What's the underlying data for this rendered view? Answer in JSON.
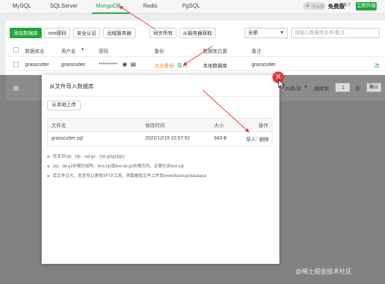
{
  "tabs": [
    {
      "label": "MySQL",
      "active": false
    },
    {
      "label": "SQLServer",
      "active": false
    },
    {
      "label": "MongoDB",
      "active": true
    },
    {
      "label": "Redis",
      "active": false
    },
    {
      "label": "PgSQL",
      "active": false
    }
  ],
  "header": {
    "vip_text": "专业版",
    "free_label": "免费版",
    "version": "7.9.7",
    "upgrade_label": "立即升级"
  },
  "toolbar": {
    "add_db": "添加数据库",
    "root_pwd": "root密码",
    "security": "安全认证",
    "remote_server": "远程服务器",
    "sync_all": "同步所有",
    "fetch_server": "从服务器获取",
    "filter_value": "全部",
    "search_placeholder": "请输入数据库名称/备注"
  },
  "table": {
    "headers": {
      "name": "数据库名",
      "user": "用户名",
      "password": "密码",
      "backup": "备份",
      "location": "数据库位置",
      "remark": "备注"
    },
    "row": {
      "name": "grasscutter",
      "user": "grasscutter",
      "password": "**********",
      "backup_status": "点击备份",
      "backup_sep": "|",
      "import": "导入",
      "location": "本地数据库",
      "remark": "grasscutter",
      "action_edge": "改"
    }
  },
  "pager": {
    "size": "20条/页",
    "goto": "跳转到",
    "page": "1",
    "unit": "页",
    "confirm": "确认"
  },
  "modal": {
    "title": "从文件导入数据库",
    "upload_button": "从本地上传",
    "file_table": {
      "headers": [
        "文件名",
        "修改时间",
        "大小",
        "操作"
      ],
      "rows": [
        {
          "name": "grasscutter.sql",
          "mtime": "2022/12/19 22:57:52",
          "size": "843 B",
          "import": "导入",
          "sep": "|",
          "delete": "删除"
        }
      ]
    },
    "notes": [
      "仅支持sql、zip、sql.gz、(tar.gz|gz|tgz)",
      "zip、tar.gz压缩包结构：test.zip或test.tar.gz压缩包内，必需包含test.sql",
      "若文件过大，您还可以使用SFTP工具，将数据库文件上传到/www/backup/database"
    ]
  },
  "watermark": "@稀土掘金技术社区",
  "colors": {
    "brand_green": "#20a53a",
    "close_red": "#e4393c",
    "arrow_red": "#e23b3b"
  }
}
